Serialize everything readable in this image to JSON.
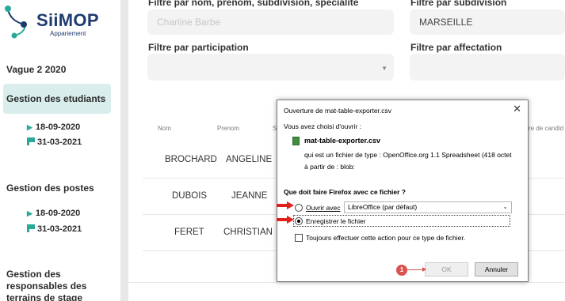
{
  "brand": {
    "name": "SiiMOP",
    "subtitle": "Appariement"
  },
  "sidebar": {
    "section_title": "Vague 2 2020",
    "items": [
      {
        "label": "Gestion des etudiants",
        "dates": [
          "18-09-2020",
          "31-03-2021"
        ]
      },
      {
        "label": "Gestion des postes",
        "dates": [
          "18-09-2020",
          "31-03-2021"
        ]
      },
      {
        "label_lines": [
          "Gestion des",
          "responsables des",
          "terrains de stage"
        ]
      }
    ]
  },
  "filters": {
    "name_label": "Filtre par nom, prenom, subdivision, specialite",
    "name_value": "Charline Barbe",
    "subdivision_label": "Filtre par subdivision",
    "subdivision_value": "MARSEILLE",
    "participation_label": "Filtre par participation",
    "affectation_label": "Filtre par affectation"
  },
  "table": {
    "headers": [
      "Nom",
      "Prenom",
      "Sc",
      "re de candid"
    ],
    "rows": [
      {
        "nom": "BROCHARD",
        "prenom": "ANGELINE"
      },
      {
        "nom": "DUBOIS",
        "prenom": "JEANNE"
      },
      {
        "nom": "FERET",
        "prenom": "CHRISTIAN"
      }
    ]
  },
  "dialog": {
    "title": "Ouverture de mat-table-exporter.csv",
    "intro": "Vous avez choisi d'ouvrir :",
    "file_name": "mat-table-exporter.csv",
    "file_type_line": "qui est un fichier de type : OpenOffice.org 1.1 Spreadsheet (418 octet",
    "source_line": "à partir de : blob:",
    "question": "Que doit faire Firefox avec ce fichier ?",
    "open_with_label": "Ouvrir avec",
    "open_with_value": "LibreOffice (par défaut)",
    "save_label": "Enregistrer le fichier",
    "always_label": "Toujours effectuer cette action pour ce type de fichier.",
    "ok_label": "OK",
    "cancel_label": "Annuler"
  },
  "annotations": {
    "step_badge": "1"
  },
  "colors": {
    "accent": "#2aa89a",
    "brand": "#1f3b6f",
    "arrow": "#e0201b",
    "active_bg": "#d9eeec"
  },
  "icons": [
    "logo-icon",
    "triangle-icon",
    "flag-icon",
    "file-csv-icon",
    "close-icon",
    "chevron-down-icon"
  ]
}
